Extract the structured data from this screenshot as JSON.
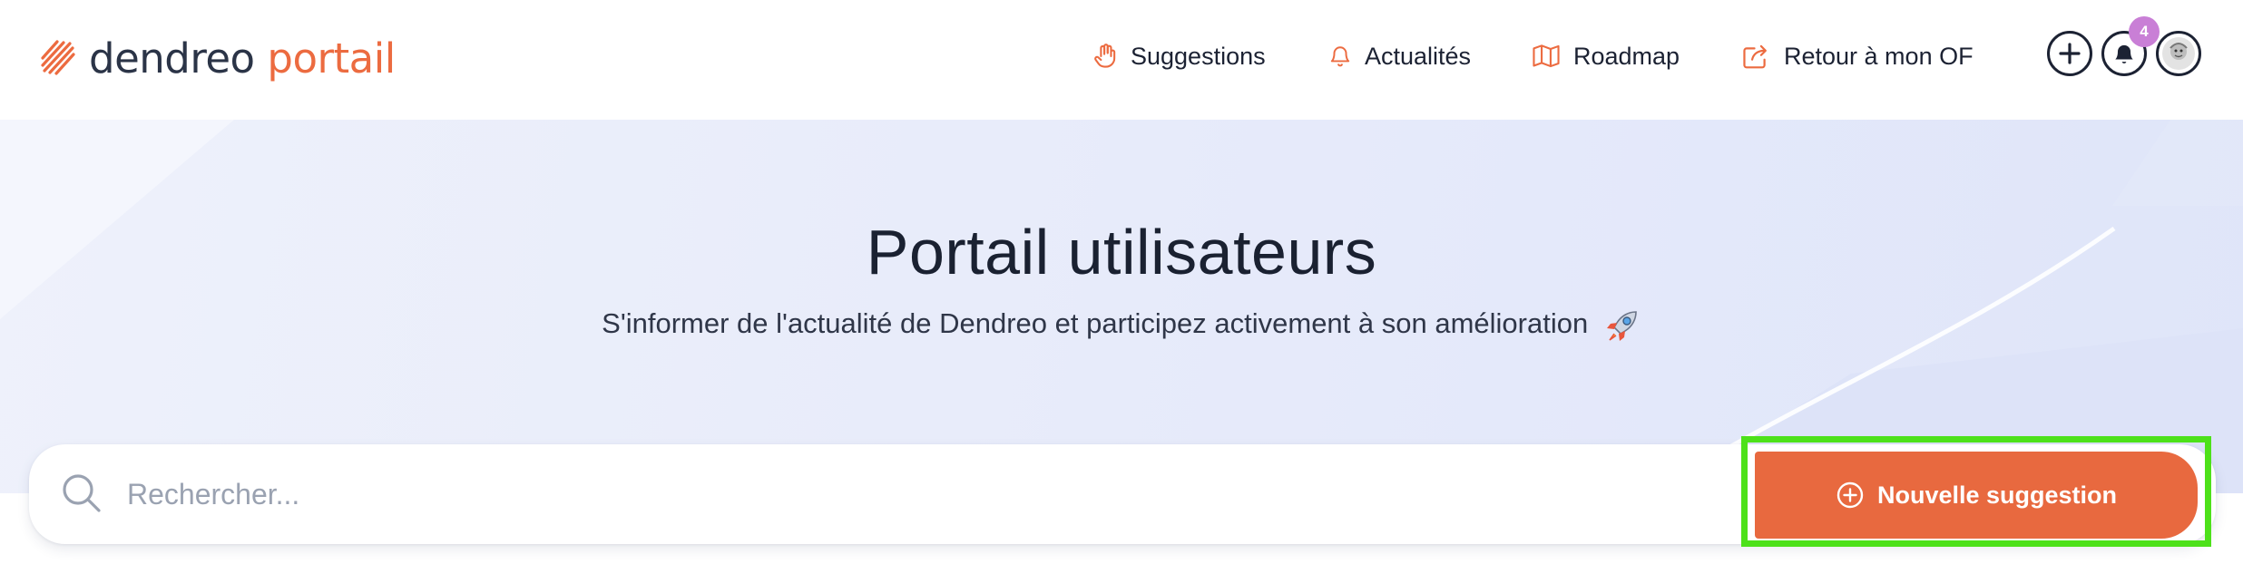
{
  "brand": {
    "name_part1": "dendreo",
    "name_part2": "portail",
    "accent": "#ec6b40",
    "logo_icon": "slashes-logo-icon"
  },
  "nav": {
    "items": [
      {
        "label": "Suggestions",
        "icon": "hand-icon"
      },
      {
        "label": "Actualités",
        "icon": "bell-icon"
      },
      {
        "label": "Roadmap",
        "icon": "map-icon"
      },
      {
        "label": "Retour à mon OF",
        "icon": "share-icon"
      }
    ],
    "notification_count": "4"
  },
  "hero": {
    "title": "Portail utilisateurs",
    "subtitle": "S'informer de l'actualité de Dendreo et participez activement à son amélioration",
    "subtitle_emoji": "rocket-icon"
  },
  "search": {
    "placeholder": "Rechercher...",
    "value": ""
  },
  "actions": {
    "new_suggestion_label": "Nouvelle suggestion"
  },
  "colors": {
    "primary_button": "#e8693f",
    "focus_highlight": "#4de11a",
    "badge": "#c97fd6",
    "text_dark": "#1c2233"
  }
}
